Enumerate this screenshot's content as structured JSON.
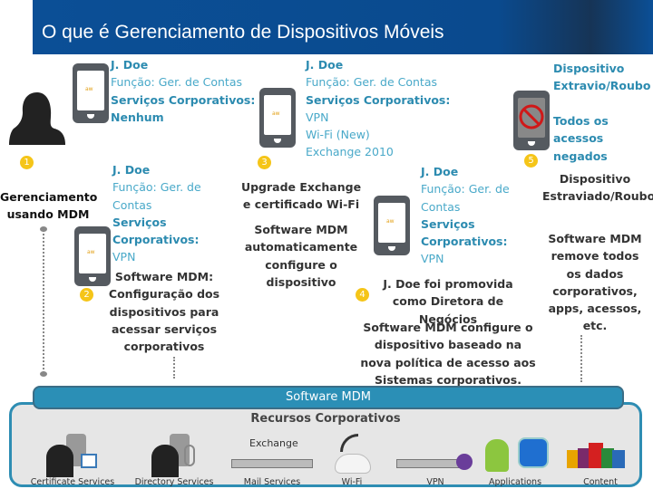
{
  "title": "O que é Gerenciamento de Dispositivos Móveis",
  "left": {
    "label": "Gerenciamento usando MDM"
  },
  "step1": {
    "badge": "1",
    "name": "J. Doe",
    "role": "Função: Ger. de Contas",
    "services_label": "Serviços Corporativos:",
    "services": "Nenhum"
  },
  "step2": {
    "badge": "2",
    "name": "J. Doe",
    "role1": "Função: Ger. de",
    "role2": "Contas",
    "services1": "Serviços",
    "services2": "Corporativos:",
    "services": "VPN",
    "desc": "Software MDM: Configuração dos dispositivos para acessar serviços corporativos"
  },
  "step3": {
    "badge": "3",
    "name": "J. Doe",
    "role": "Função: Ger. de Contas",
    "services_label": "Serviços Corporativos:",
    "s1": "VPN",
    "s2": "Wi-Fi (New)",
    "s3": "Exchange 2010",
    "desc1": "Upgrade Exchange e certificado Wi-Fi",
    "desc2": "Software MDM automaticamente configure o dispositivo"
  },
  "step4": {
    "badge": "4",
    "name": "J. Doe",
    "role1": "Função: Ger. de",
    "role2": "Contas",
    "services1": "Serviços",
    "services2": "Corporativos:",
    "services": "VPN",
    "desc1": "J. Doe foi promovida como Diretora de Negócios",
    "desc2": "Software MDM configure o dispositivo baseado na nova política de acesso aos Sistemas corporativos."
  },
  "step5": {
    "badge": "5",
    "title": "Dispositivo Extravio/Roubo",
    "denied": "Todos os acessos negados",
    "desc1": "Dispositivo Estraviado/Roubo",
    "desc2": "Software MDM remove todos os dados corporativos, apps, acessos, etc."
  },
  "mdm_bar": "Software MDM",
  "resources": {
    "title": "Recursos Corporativos",
    "exchange_logo": "Exchange",
    "items": [
      {
        "label": "Certificate Services",
        "icon": "certificate-server-icon"
      },
      {
        "label": "Directory Services",
        "icon": "directory-keys-icon"
      },
      {
        "label": "Mail Services",
        "icon": "exchange-server-icon"
      },
      {
        "label": "Wi-Fi",
        "icon": "wifi-router-icon"
      },
      {
        "label": "VPN",
        "icon": "vpn-appliance-icon"
      },
      {
        "label": "Applications",
        "icon": "app-store-icon"
      },
      {
        "label": "Content",
        "icon": "documents-icon"
      }
    ]
  },
  "colors": {
    "header": "#0b4f96",
    "accent": "#2c8bb0",
    "badge": "#f5c518",
    "mdm_bar": "#2b8fb6"
  }
}
